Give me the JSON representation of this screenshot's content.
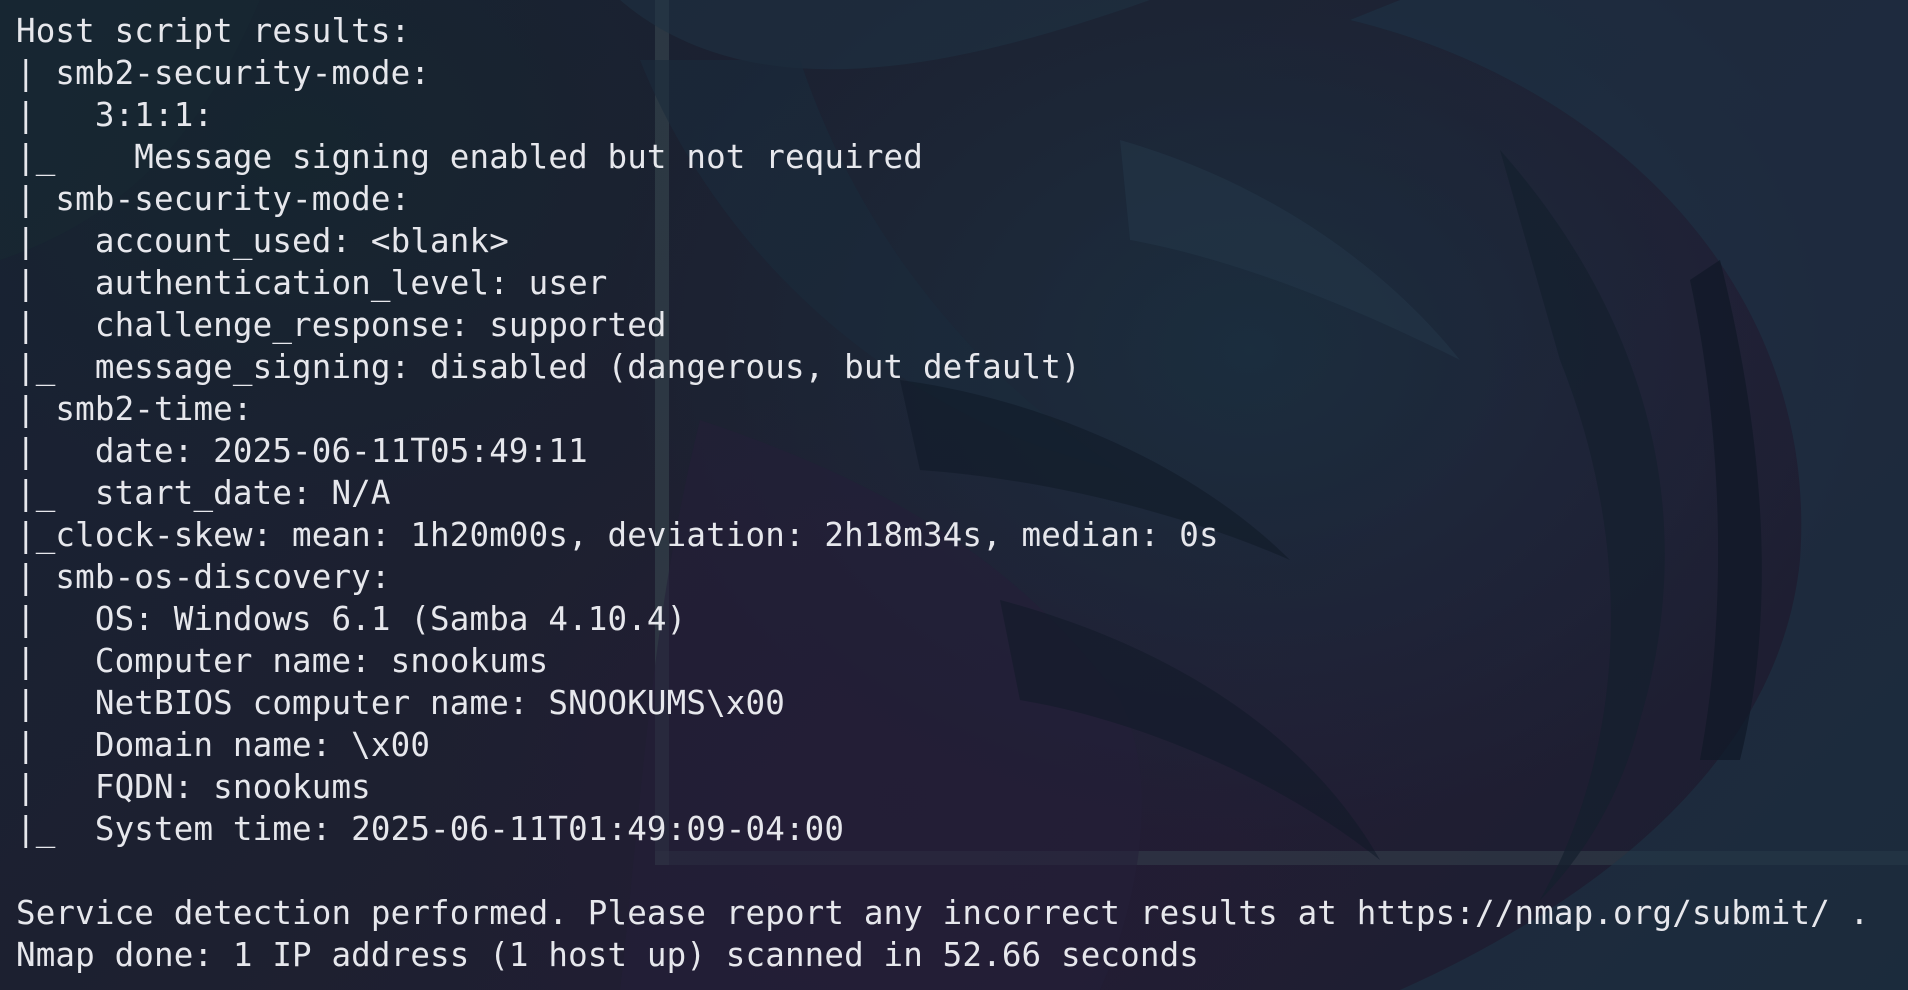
{
  "terminal": {
    "lines": [
      "Host script results:",
      "| smb2-security-mode:",
      "|   3:1:1:",
      "|_    Message signing enabled but not required",
      "| smb-security-mode:",
      "|   account_used: <blank>",
      "|   authentication_level: user",
      "|   challenge_response: supported",
      "|_  message_signing: disabled (dangerous, but default)",
      "| smb2-time:",
      "|   date: 2025-06-11T05:49:11",
      "|_  start_date: N/A",
      "|_clock-skew: mean: 1h20m00s, deviation: 2h18m34s, median: 0s",
      "| smb-os-discovery:",
      "|   OS: Windows 6.1 (Samba 4.10.4)",
      "|   Computer name: snookums",
      "|   NetBIOS computer name: SNOOKUMS\\x00",
      "|   Domain name: \\x00",
      "|   FQDN: snookums",
      "|_  System time: 2025-06-11T01:49:09-04:00",
      "",
      "Service detection performed. Please report any incorrect results at https://nmap.org/submit/ .",
      "Nmap done: 1 IP address (1 host up) scanned in 52.66 seconds"
    ]
  },
  "colors": {
    "text": "#e6e7ec",
    "background": "#1b1d2e",
    "leaf_dark": "#14202e",
    "leaf_light": "#23384a",
    "frame_line": "#3a4a52"
  }
}
